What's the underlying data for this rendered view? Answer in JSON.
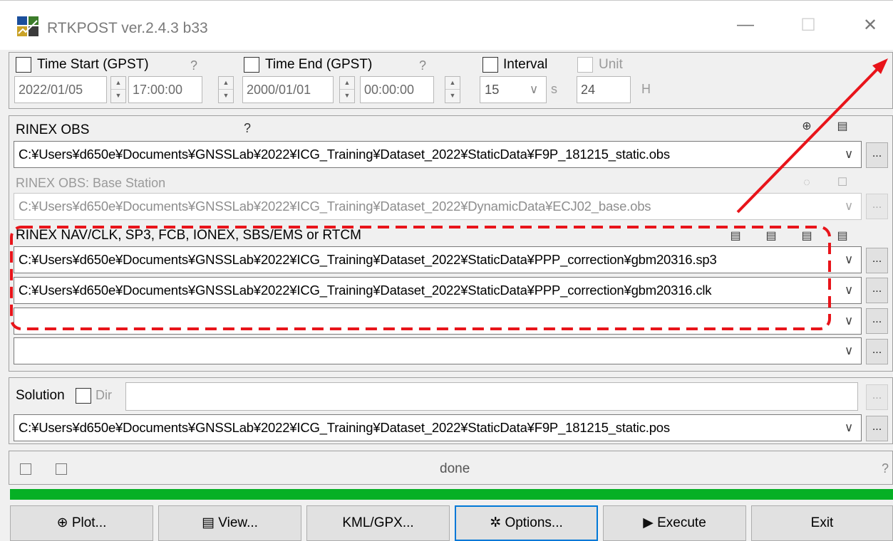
{
  "window": {
    "title": "RTKPOST ver.2.4.3 b33",
    "minimize": "—",
    "maximize": "☐",
    "close": "✕"
  },
  "time": {
    "start_label": "Time Start (GPST)",
    "start_help": "?",
    "start_date": "2022/01/05",
    "start_time": "17:00:00",
    "end_label": "Time End (GPST)",
    "end_help": "?",
    "end_date": "2000/01/01",
    "end_time": "00:00:00",
    "interval_label": "Interval",
    "interval_value": "15",
    "interval_unit": "s",
    "unit_label": "Unit",
    "unit_value": "24",
    "unit_suffix": "H"
  },
  "rinex_obs": {
    "label": "RINEX OBS",
    "help": "?",
    "rover_path": "C:¥Users¥d650e¥Documents¥GNSSLab¥2022¥ICG_Training¥Dataset_2022¥StaticData¥F9P_181215_static.obs",
    "base_label": "RINEX OBS: Base Station",
    "base_path": "C:¥Users¥d650e¥Documents¥GNSSLab¥2022¥ICG_Training¥Dataset_2022¥DynamicData¥ECJ02_base.obs"
  },
  "nav": {
    "label": "RINEX NAV/CLK, SP3, FCB, IONEX, SBS/EMS  or RTCM",
    "files": [
      "C:¥Users¥d650e¥Documents¥GNSSLab¥2022¥ICG_Training¥Dataset_2022¥StaticData¥PPP_correction¥gbm20316.sp3",
      "C:¥Users¥d650e¥Documents¥GNSSLab¥2022¥ICG_Training¥Dataset_2022¥StaticData¥PPP_correction¥gbm20316.clk",
      "",
      ""
    ]
  },
  "solution": {
    "label": "Solution",
    "dir_label": "Dir",
    "dir_value": "",
    "output_path": "C:¥Users¥d650e¥Documents¥GNSSLab¥2022¥ICG_Training¥Dataset_2022¥StaticData¥F9P_181215_static.pos"
  },
  "status": {
    "message": "done",
    "help": "?",
    "progress": 1.0
  },
  "buttons": {
    "plot": "Plot...",
    "view": "View...",
    "kml": "KML/GPX...",
    "options": "Options...",
    "execute": "Execute",
    "exit": "Exit"
  },
  "ellipsis": "...",
  "colors": {
    "progress": "#06b025",
    "annotation": "#e8141a",
    "focus": "#0078d7"
  },
  "icons": {
    "plot": "globe-icon",
    "view": "text-file-icon",
    "options": "gear-icon",
    "execute": "play-icon"
  }
}
